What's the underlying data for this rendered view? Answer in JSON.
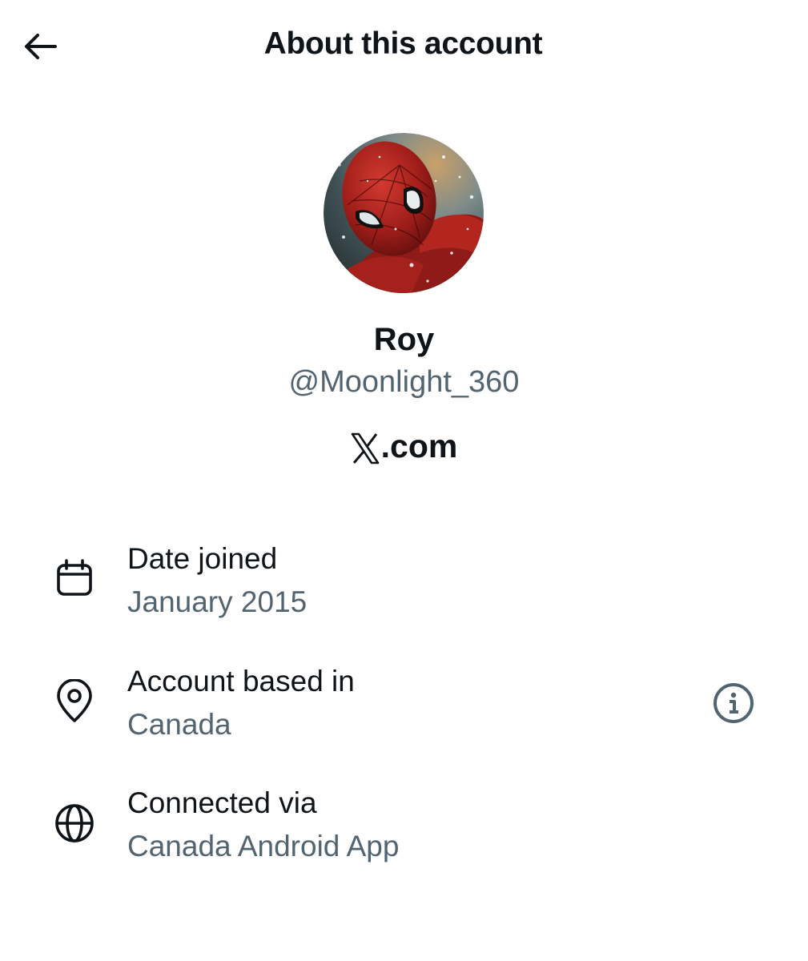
{
  "header": {
    "title": "About this account",
    "back_icon": "arrow-left-icon"
  },
  "profile": {
    "display_name": "Roy",
    "handle": "@Moonlight_360",
    "site_text": ".com",
    "site_logo_icon": "x-logo-icon",
    "avatar": "spider-man-avatar"
  },
  "details": [
    {
      "icon": "calendar-icon",
      "label": "Date joined",
      "value": "January 2015"
    },
    {
      "icon": "location-pin-icon",
      "label": "Account based in",
      "value": "Canada",
      "action_icon": "info-icon"
    },
    {
      "icon": "globe-icon",
      "label": "Connected via",
      "value": "Canada Android App"
    }
  ],
  "colors": {
    "text_primary": "#0f1419",
    "text_secondary": "#536471",
    "background": "#ffffff"
  }
}
